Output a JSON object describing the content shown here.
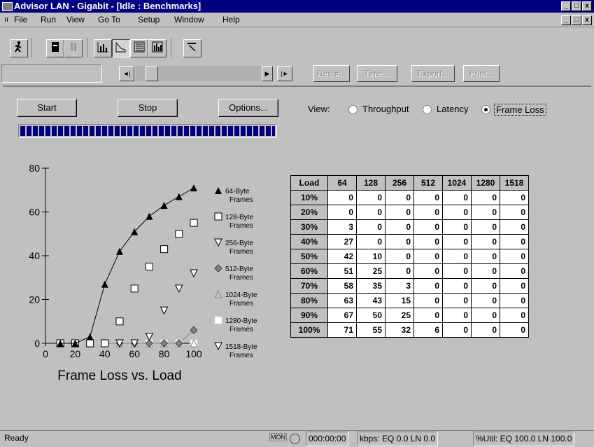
{
  "window": {
    "title": "Advisor LAN - Gigabit - [Idle : Benchmarks]",
    "controls": [
      "_",
      "□",
      "x"
    ]
  },
  "menubar": {
    "items": [
      "File",
      "Run",
      "View",
      "Go To",
      "Setup",
      "Window",
      "Help"
    ]
  },
  "toolbar": {
    "icons": [
      "run-icon",
      "record-icon",
      "pause-icon",
      "bar-chart-icon",
      "line-chart-icon",
      "list-icon",
      "histogram-icon",
      "pointer-icon"
    ]
  },
  "nav": {
    "rec_label": "Rec #...",
    "time_label": "Time...",
    "export_label": "Export...",
    "print_label": "Print..."
  },
  "controls": {
    "start_label": "Start",
    "stop_label": "Stop",
    "options_label": "Options...",
    "view_label": "View:",
    "view_options": [
      "Throughput",
      "Latency",
      "Frame Loss"
    ],
    "view_selected": "Frame Loss",
    "progress_fraction": 1.0
  },
  "chart_data": {
    "type": "line",
    "title": "Frame Loss vs. Load",
    "xlabel": "",
    "ylabel": "",
    "x": [
      10,
      20,
      30,
      40,
      50,
      60,
      70,
      80,
      90,
      100
    ],
    "xticks": [
      0,
      20,
      40,
      60,
      80,
      100
    ],
    "yticks": [
      0,
      20,
      40,
      60,
      80
    ],
    "xlim": [
      0,
      100
    ],
    "ylim": [
      0,
      80
    ],
    "legend_position": "right",
    "series": [
      {
        "name": "64-Byte Frames",
        "marker": "triangle-up-filled",
        "line": true,
        "values": [
          0,
          0,
          3,
          27,
          42,
          51,
          58,
          63,
          67,
          71
        ]
      },
      {
        "name": "128-Byte Frames",
        "marker": "square-open",
        "line": true,
        "values": [
          0,
          0,
          0,
          0,
          10,
          25,
          35,
          43,
          50,
          55
        ]
      },
      {
        "name": "256-Byte Frames",
        "marker": "triangle-down-open",
        "line": false,
        "values": [
          0,
          0,
          0,
          0,
          0,
          0,
          3,
          15,
          25,
          32
        ]
      },
      {
        "name": "512-Byte Frames",
        "marker": "diamond-filled",
        "line": true,
        "values": [
          0,
          0,
          0,
          0,
          0,
          0,
          0,
          0,
          0,
          6
        ]
      },
      {
        "name": "1024-Byte Frames",
        "marker": "triangle-up-open",
        "line": false,
        "values": [
          0,
          0,
          0,
          0,
          0,
          0,
          0,
          0,
          0,
          0
        ]
      },
      {
        "name": "1280-Byte Frames",
        "marker": "square-white",
        "line": false,
        "values": [
          0,
          0,
          0,
          0,
          0,
          0,
          0,
          0,
          0,
          0
        ]
      },
      {
        "name": "1518-Byte Frames",
        "marker": "triangle-down-open",
        "line": false,
        "values": [
          0,
          0,
          0,
          0,
          0,
          0,
          0,
          0,
          0,
          0
        ]
      }
    ]
  },
  "table": {
    "headers": [
      "Load",
      "64",
      "128",
      "256",
      "512",
      "1024",
      "1280",
      "1518"
    ],
    "rows": [
      [
        "10%",
        "0",
        "0",
        "0",
        "0",
        "0",
        "0",
        "0"
      ],
      [
        "20%",
        "0",
        "0",
        "0",
        "0",
        "0",
        "0",
        "0"
      ],
      [
        "30%",
        "3",
        "0",
        "0",
        "0",
        "0",
        "0",
        "0"
      ],
      [
        "40%",
        "27",
        "0",
        "0",
        "0",
        "0",
        "0",
        "0"
      ],
      [
        "50%",
        "42",
        "10",
        "0",
        "0",
        "0",
        "0",
        "0"
      ],
      [
        "60%",
        "51",
        "25",
        "0",
        "0",
        "0",
        "0",
        "0"
      ],
      [
        "70%",
        "58",
        "35",
        "3",
        "0",
        "0",
        "0",
        "0"
      ],
      [
        "80%",
        "63",
        "43",
        "15",
        "0",
        "0",
        "0",
        "0"
      ],
      [
        "90%",
        "67",
        "50",
        "25",
        "0",
        "0",
        "0",
        "0"
      ],
      [
        "100%",
        "71",
        "55",
        "32",
        "6",
        "0",
        "0",
        "0"
      ]
    ]
  },
  "status": {
    "ready": "Ready",
    "mon": "MON",
    "time": "000:00:00",
    "kbps": "kbps: EQ 0.0  LN 0.0",
    "util": "%Util: EQ 100.0  LN 100.0"
  },
  "colors": {
    "titlebar": "#000080",
    "face": "#c0c0c0",
    "progress": "#000080"
  }
}
